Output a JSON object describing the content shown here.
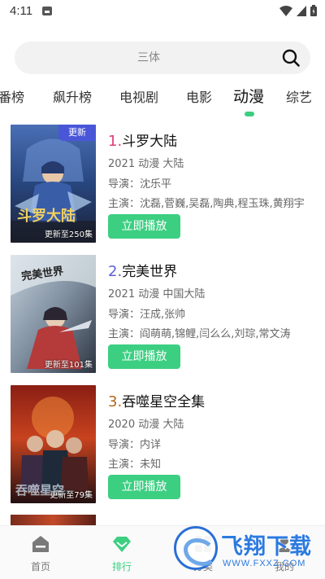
{
  "status_bar": {
    "time": "4:11"
  },
  "search": {
    "placeholder": "三体"
  },
  "tabs": [
    "番榜",
    "飙升榜",
    "电视剧",
    "电影",
    "动漫",
    "综艺"
  ],
  "active_tab": "动漫",
  "items": [
    {
      "rank": "1.",
      "title": "斗罗大陆",
      "meta": "2021  动漫  大陆",
      "director": "导演：沈乐平",
      "cast": "主演：沈磊,菅巍,吴磊,陶典,程玉珠,黄翔宇",
      "update": "更新至250集",
      "badge": "更新",
      "play_label": "立即播放",
      "rank_color": "#e23b7a"
    },
    {
      "rank": "2.",
      "title": "完美世界",
      "meta": "2021  动漫  中国大陆",
      "director": "导演：汪成,张帅",
      "cast": "主演：阎萌萌,锦鲤,闫么么,刘琮,常文涛",
      "update": "更新至101集",
      "play_label": "立即播放",
      "rank_color": "#5a5fd6"
    },
    {
      "rank": "3.",
      "title": "吞噬星空全集",
      "meta": "2020  动漫  大陆",
      "director": "导演：内详",
      "cast": "主演：未知",
      "update": "更新至79集",
      "play_label": "立即播放",
      "rank_color": "#b5651d"
    }
  ],
  "bottom_nav": [
    {
      "label": "首页",
      "icon": "home-icon"
    },
    {
      "label": "排行",
      "icon": "diamond-icon"
    },
    {
      "label": "分类",
      "icon": "category-icon"
    },
    {
      "label": "我的",
      "icon": "profile-icon"
    }
  ],
  "watermark": {
    "title": "飞翔下载",
    "url": "WWW.FXXZ.COM"
  },
  "colors": {
    "accent": "#3ccf82",
    "badge": "#4a56d8"
  }
}
